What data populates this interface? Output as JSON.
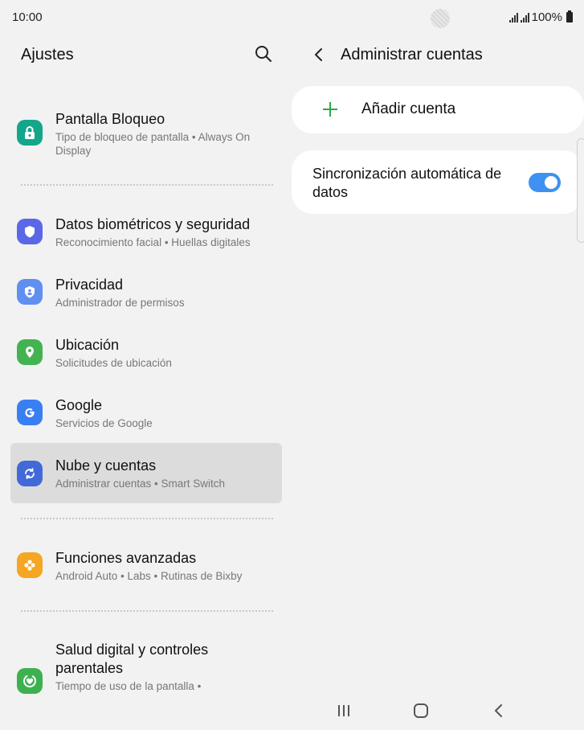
{
  "status": {
    "time": "10:00",
    "battery": "100%"
  },
  "left": {
    "title": "Ajustes",
    "items": [
      {
        "title": "Pantalla Bloqueo",
        "subtitle": "Tipo de bloqueo de pantalla  •  Always On Display",
        "icon": "lock-icon",
        "color": "#14a68a"
      },
      {
        "title": "Datos biométricos y seguridad",
        "subtitle": "Reconocimiento facial  •  Huellas digitales",
        "icon": "shield-icon",
        "color": "#5b68e6"
      },
      {
        "title": "Privacidad",
        "subtitle": "Administrador de permisos",
        "icon": "privacy-icon",
        "color": "#5f8ff0"
      },
      {
        "title": "Ubicación",
        "subtitle": "Solicitudes de ubicación",
        "icon": "location-icon",
        "color": "#43b352"
      },
      {
        "title": "Google",
        "subtitle": "Servicios de Google",
        "icon": "google-icon",
        "color": "#3a7ff2"
      },
      {
        "title": "Nube y cuentas",
        "subtitle": "Administrar cuentas  •  Smart Switch",
        "icon": "sync-icon",
        "color": "#4169d8"
      },
      {
        "title": "Funciones avanzadas",
        "subtitle": "Android Auto  •  Labs  •  Rutinas de Bixby",
        "icon": "gear-flower-icon",
        "color": "#f5a623"
      },
      {
        "title": "Salud digital y controles parentales",
        "subtitle": "Tiempo de uso de la pantalla  •",
        "icon": "digital-wellbeing-icon",
        "color": "#3db14f"
      }
    ]
  },
  "right": {
    "title": "Administrar cuentas",
    "add_account": "Añadir cuenta",
    "sync_label": "Sincronización automática de datos",
    "sync_on": true
  },
  "colors": {
    "accent": "#3e91f0",
    "plus": "#2aa84a",
    "active_row": "#dcdcdc"
  }
}
